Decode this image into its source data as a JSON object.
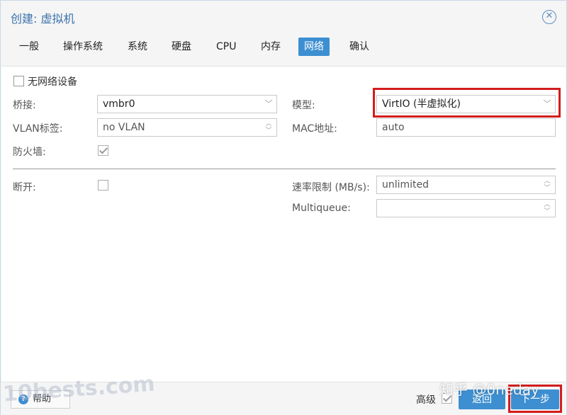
{
  "window": {
    "title": "创建: 虚拟机"
  },
  "tabs": [
    {
      "label": "一般"
    },
    {
      "label": "操作系统"
    },
    {
      "label": "系统"
    },
    {
      "label": "硬盘"
    },
    {
      "label": "CPU"
    },
    {
      "label": "内存"
    },
    {
      "label": "网络",
      "active": true
    },
    {
      "label": "确认"
    }
  ],
  "form": {
    "no_network": {
      "label": "无网络设备",
      "checked": false
    },
    "bridge": {
      "label": "桥接:",
      "value": "vmbr0"
    },
    "vlan": {
      "label": "VLAN标签:",
      "value": "no VLAN"
    },
    "firewall": {
      "label": "防火墙:",
      "checked": true
    },
    "model": {
      "label": "模型:",
      "value": "VirtIO (半虚拟化)"
    },
    "mac": {
      "label": "MAC地址:",
      "value": "auto"
    },
    "disconnect": {
      "label": "断开:",
      "checked": false
    },
    "rate": {
      "label": "速率限制 (MB/s):",
      "value": "unlimited"
    },
    "multiqueue": {
      "label": "Multiqueue:",
      "value": ""
    }
  },
  "footer": {
    "help_label": "帮助",
    "advanced_label": "高级",
    "advanced_checked": true,
    "back_label": "返回",
    "next_label": "下一步"
  },
  "watermarks": {
    "left": "10bests.com",
    "right": "知乎 @0neday"
  },
  "colors": {
    "accent": "#3d8fd1",
    "title": "#3a72ac",
    "highlight": "#d41c1c"
  }
}
